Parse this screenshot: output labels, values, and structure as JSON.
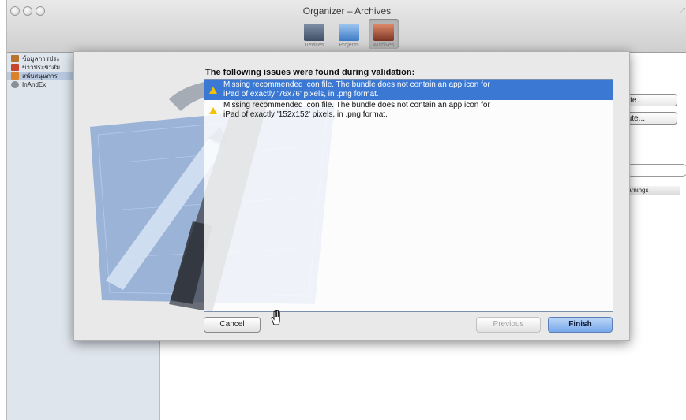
{
  "window": {
    "title": "Organizer – Archives",
    "toolbar": [
      {
        "label": "Devices",
        "icon": "devices-icon",
        "active": false
      },
      {
        "label": "Projects",
        "icon": "projects-icon",
        "active": false
      },
      {
        "label": "Archives",
        "icon": "archives-icon",
        "active": true
      }
    ]
  },
  "sidebar": {
    "items": [
      {
        "label": "ข้อมูลการประ",
        "icon": "app-icon",
        "color": "#b8742e"
      },
      {
        "label": "ข่าวประชาสัม",
        "icon": "app-icon",
        "color": "#c6462e"
      },
      {
        "label": "สนับสนุนการ",
        "icon": "app-icon",
        "color": "#d9822b",
        "selected": true
      },
      {
        "label": "InAndEx",
        "icon": "app-icon",
        "color": "#8a8f96"
      }
    ]
  },
  "background_panel": {
    "buttons": [
      "date...",
      "ibute..."
    ],
    "column_header": "Warnings"
  },
  "sheet": {
    "heading": "The following issues were found during validation:",
    "issues": [
      {
        "lines": [
          "Missing recommended icon file. The bundle does not contain an app icon for",
          "iPad of exactly '76x76' pixels, in .png format."
        ],
        "selected": true
      },
      {
        "lines": [
          "Missing recommended icon file. The bundle does not contain an app icon for",
          "iPad of exactly '152x152' pixels, in .png format."
        ],
        "selected": false
      }
    ],
    "buttons": {
      "cancel": "Cancel",
      "previous": "Previous",
      "finish": "Finish"
    }
  },
  "colors": {
    "selection": "#3a78d3",
    "warning": "#f2c200"
  }
}
